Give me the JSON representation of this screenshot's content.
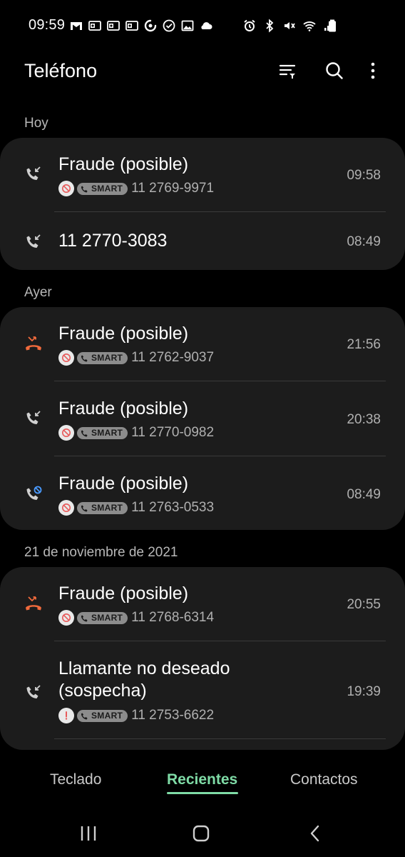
{
  "status_bar": {
    "time": "09:59",
    "left_icons": [
      "gmail-icon",
      "outlook-icon",
      "outlook-icon",
      "outlook-icon",
      "sync-icon",
      "check-circle-icon",
      "image-icon",
      "cloud-icon"
    ],
    "right_icons": [
      "alarm-icon",
      "bluetooth-icon",
      "mute-icon",
      "wifi-icon",
      "signal-icon",
      "battery-icon"
    ]
  },
  "app_bar": {
    "title": "Teléfono",
    "actions": [
      "filter-icon",
      "search-icon",
      "more-icon"
    ]
  },
  "sections": [
    {
      "header": "Hoy",
      "calls": [
        {
          "name": "Fraude (posible)",
          "badge": "block",
          "smart": "SMART",
          "number": "11 2769-9971",
          "time": "09:58",
          "type": "incoming"
        },
        {
          "name": "11 2770-3083",
          "time": "08:49",
          "type": "incoming"
        }
      ]
    },
    {
      "header": "Ayer",
      "calls": [
        {
          "name": "Fraude (posible)",
          "badge": "block",
          "smart": "SMART",
          "number": "11 2762-9037",
          "time": "21:56",
          "type": "missed"
        },
        {
          "name": "Fraude (posible)",
          "badge": "block",
          "smart": "SMART",
          "number": "11 2770-0982",
          "time": "20:38",
          "type": "incoming"
        },
        {
          "name": "Fraude (posible)",
          "badge": "block",
          "smart": "SMART",
          "number": "11 2763-0533",
          "time": "08:49",
          "type": "blocked"
        }
      ]
    },
    {
      "header": "21 de noviembre de 2021",
      "calls": [
        {
          "name": "Fraude (posible)",
          "badge": "block",
          "smart": "SMART",
          "number": "11 2768-6314",
          "time": "20:55",
          "type": "missed"
        },
        {
          "name": "Llamante no deseado (sospecha)",
          "name_line1": "Llamante no deseado",
          "name_line2": "(sospecha)",
          "badge": "warning",
          "smart": "SMART",
          "number": "11 2753-6622",
          "time": "19:39",
          "type": "incoming"
        }
      ]
    }
  ],
  "tabs": [
    {
      "label": "Teclado",
      "active": false
    },
    {
      "label": "Recientes",
      "active": true
    },
    {
      "label": "Contactos",
      "active": false
    }
  ],
  "nav_bar": [
    "recents-nav-icon",
    "home-nav-icon",
    "back-nav-icon"
  ],
  "colors": {
    "background": "#000000",
    "card": "#1c1c1c",
    "accent": "#7fdba6",
    "missed": "#f06a3c",
    "blocked_badge": "#e85a5a"
  }
}
